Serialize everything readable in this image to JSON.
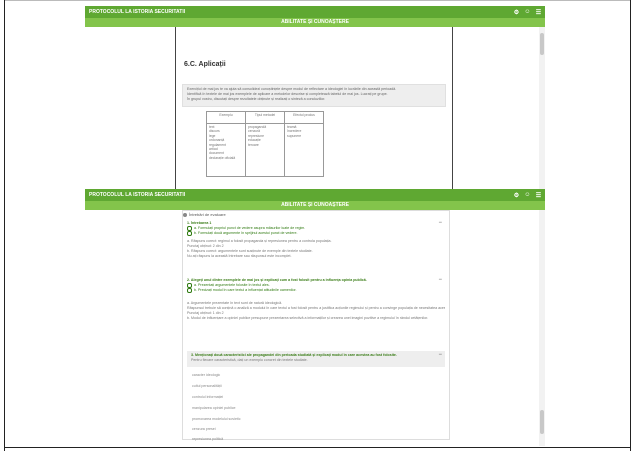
{
  "window1": {
    "brand": "PROTOCOLUL LA ISTORIA SECURITATII",
    "subheader": "ABILITATE ȘI CUNOAȘTERE",
    "section_title": "6.C. Aplicații",
    "info_lines": [
      "Exercițiul de mai jos te va ajuta să consolidezi cunoștințele despre modul de reflectare a ideologiei în lucrările din această perioadă.",
      "Identifică în textele de mai jos exemplele de aplicare a metodelor descrise și completează tabelul de mai jos. Lucrați pe grupe.",
      "În grupul vostru, discutați despre rezultatele obținute și realizați o sinteză a concluziilor."
    ],
    "table": {
      "headers": [
        "Exemplu",
        "Tipul metodei",
        "Efectul produs"
      ],
      "col1": [
        "text",
        "discurs",
        "lege",
        "ordonanță",
        "regulament",
        "articol",
        "document",
        "declarație oficială"
      ],
      "col2": [
        "propagandă",
        "cenzură",
        "represiune",
        "educație",
        "teroare"
      ],
      "col3": [
        "teamă",
        "încredere",
        "supunere"
      ]
    },
    "icons": [
      "gear-icon",
      "user-icon",
      "menu-icon"
    ]
  },
  "window2": {
    "brand": "PROTOCOLUL LA ISTORIA SECURITATII",
    "subheader": "ABILITATE ȘI CUNOAȘTERE",
    "partial_heading": "Întrebări de evaluare",
    "q1": {
      "title": "1. Întrebarea 1",
      "toggle": "−",
      "options": [
        "a. Formulați propriul punct de vedere asupra măsurilor luate de regim.",
        "b. Formulați două argumente în sprijinul acestui punct de vedere."
      ],
      "feedback": [
        "a. Răspuns corect: regimul a folosit propaganda și represiunea pentru a controla populația.",
        "Punctaj obținut: 2 din 2",
        "b. Răspuns corect: argumentele sunt susținute de exemple din textele studiate.",
        "Nu ați răspuns la această întrebare sau răspunsul este incomplet."
      ]
    },
    "q2": {
      "title": "2. Alegeți unul dintre exemplele de mai jos și explicați cum a fost folosit pentru a influența opinia publică.",
      "toggle": "−",
      "options": [
        "a. Prezentați argumentele folosite în textul ales.",
        "b. Precizați modul în care textul a influențat atitudinile oamenilor."
      ],
      "feedback": [
        "a. Argumentele prezentate în text sunt de natură ideologică.",
        "Răspunsul trebuie să conțină o analiză a modului în care textul a fost folosit pentru a justifica acțiunile regimului și pentru a convinge populația de necesitatea acestora.",
        "Punctaj obținut: 1 din 2",
        "b. Modul de influențare a opiniei publice presupune prezentarea selectivă a informațiilor și crearea unei imagini pozitive a regimului în rândul cetățenilor."
      ]
    },
    "q3": {
      "title": "3. Menționați două caracteristici ale propagandei din perioada studiată și explicați modul în care acestea au fost folosite.",
      "line2": "Pentru fiecare caracteristică, dați un exemplu concret din textele studiate.",
      "toggle": "−",
      "answers": [
        "caracter ideologic",
        "cultul personalității",
        "controlul informației",
        "manipularea opiniei publice",
        "promovarea modelului sovietic",
        "cenzura presei",
        "represiunea politică"
      ]
    },
    "icons": [
      "gear-icon",
      "user-icon",
      "menu-icon"
    ]
  }
}
